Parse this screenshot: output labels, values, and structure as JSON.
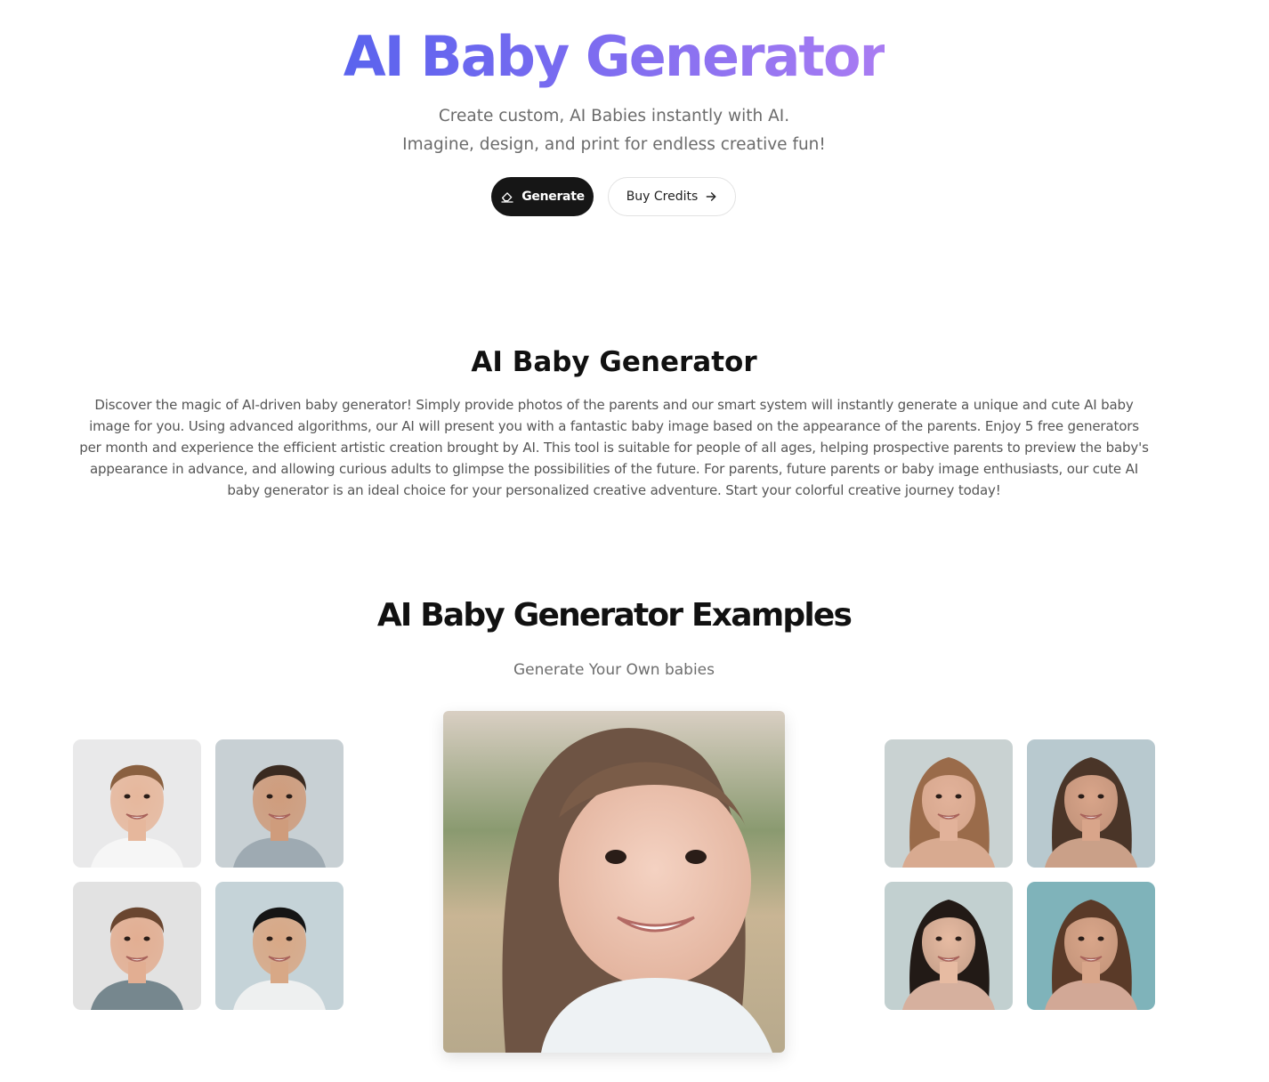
{
  "hero": {
    "title": "AI Baby Generator",
    "subtitle_line1": "Create custom, AI Babies instantly with AI.",
    "subtitle_line2": "Imagine, design, and print for endless creative fun!",
    "gradient_colors": [
      "#5a63ee",
      "#a97cf2"
    ]
  },
  "buttons": {
    "generate": {
      "label": "Generate",
      "icon": "eraser-icon"
    },
    "buy_credits": {
      "label": "Buy Credits",
      "icon": "arrow-right-icon"
    }
  },
  "about": {
    "title": "AI Baby Generator",
    "description": "Discover the magic of AI-driven baby generator! Simply provide photos of the parents and our smart system will instantly generate a unique and cute AI baby image for you. Using advanced algorithms, our AI will present you with a fantastic baby image based on the appearance of the parents. Enjoy 5 free generators per month and experience the efficient artistic creation brought by AI. This tool is suitable for people of all ages, helping prospective parents to preview the baby's appearance in advance, and allowing curious adults to glimpse the possibilities of the future. For parents, future parents or baby image enthusiasts, our cute AI baby generator is an ideal choice for your personalized creative adventure. Start your colorful creative journey today!"
  },
  "examples": {
    "title": "AI Baby Generator Examples",
    "subtitle": "Generate Your Own babies",
    "fathers": [
      {
        "alt": "Smiling man with light brown hair and beard, white t-shirt",
        "bg": "#e9e9ea",
        "hair": "#8a6040",
        "skin": "#e6b79c",
        "shirt": "#f6f6f6"
      },
      {
        "alt": "Smiling man with dark curly hair and stubble, grey t-shirt",
        "bg": "#c8d0d4",
        "hair": "#3a2a20",
        "skin": "#cf9c7c",
        "shirt": "#9eaab2"
      },
      {
        "alt": "Smiling man with brown hair, grey-green t-shirt",
        "bg": "#e2e2e2",
        "hair": "#6a4630",
        "skin": "#e2ae92",
        "shirt": "#76878e"
      },
      {
        "alt": "Smiling Asian man with black hair, white t-shirt",
        "bg": "#c5d3d8",
        "hair": "#151515",
        "skin": "#d8a886",
        "shirt": "#eef0f0"
      }
    ],
    "mothers": [
      {
        "alt": "Smiling woman with long light brown hair",
        "bg": "#c9d2d2",
        "hair": "#9a6b4a",
        "skin": "#e2b29a",
        "shirt": "#d8aa90"
      },
      {
        "alt": "Laughing woman with dark hair tied up",
        "bg": "#b8c9cf",
        "hair": "#4a3528",
        "skin": "#d9a58a",
        "shirt": "#caa088"
      },
      {
        "alt": "Asian woman with dark hair",
        "bg": "#c2d0d0",
        "hair": "#221a16",
        "skin": "#e7bba2",
        "shirt": "#d6b09e"
      },
      {
        "alt": "Smiling woman with brown hair on teal background",
        "bg": "#7fb3ba",
        "hair": "#5a3a28",
        "skin": "#d9a68a",
        "shirt": "#d2a896"
      }
    ],
    "baby": {
      "alt": "Smiling young girl with long brown hair, white t-shirt, outdoor background"
    }
  }
}
